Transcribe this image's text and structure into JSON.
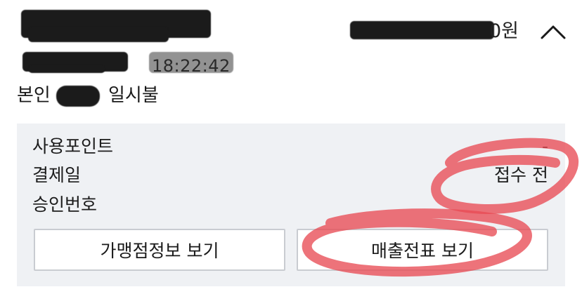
{
  "header": {
    "amount_suffix": "0원",
    "collapse_icon": "chevron-up-icon",
    "time": "18:22:42"
  },
  "card": {
    "owner_label": "본인",
    "installment": "일시불"
  },
  "details": {
    "rows": [
      {
        "label": "사용포인트",
        "value": "-"
      },
      {
        "label": "결제일",
        "value": "접수 전"
      },
      {
        "label": "승인번호",
        "value": ""
      }
    ]
  },
  "buttons": {
    "merchant_info": "가맹점정보 보기",
    "sales_slip": "매출전표 보기"
  },
  "colors": {
    "panel_bg": "#eff1f4",
    "button_border": "#c9ccd1",
    "redaction": "#1b1b1b",
    "annotation": "#e84b55"
  }
}
